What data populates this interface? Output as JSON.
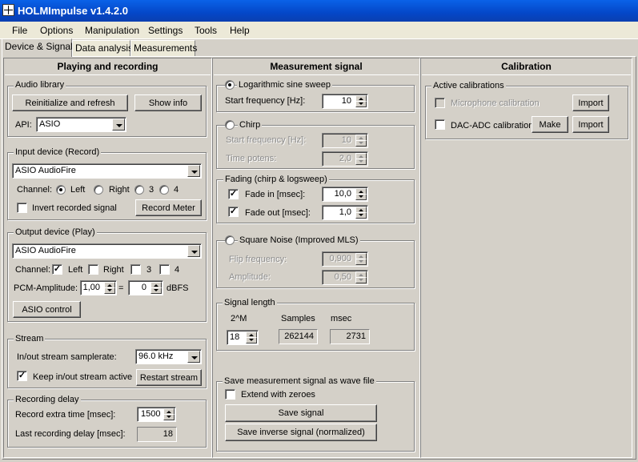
{
  "app": {
    "title": "HOLMImpulse  v1.4.2.0"
  },
  "menu": [
    "File",
    "Options",
    "Manipulation",
    "Settings",
    "Tools",
    "Help"
  ],
  "tabs": [
    "Device & Signal",
    "Data analysis",
    "Measurements"
  ],
  "col1": {
    "heading": "Playing and recording",
    "audio_library": {
      "title": "Audio library",
      "reinit_button": "Reinitialize and refresh",
      "show_info_button": "Show info",
      "api_label": "API:",
      "api_value": "ASIO"
    },
    "input_device": {
      "title": "Input device (Record)",
      "device": "ASIO AudioFire",
      "channel_label": "Channel:",
      "channels": [
        "Left",
        "Right",
        "3",
        "4"
      ],
      "invert_label": "Invert recorded signal",
      "record_meter_button": "Record Meter"
    },
    "output_device": {
      "title": "Output device (Play)",
      "device": "ASIO AudioFire",
      "channel_label": "Channel:",
      "channels": [
        "Left",
        "Right",
        "3",
        "4"
      ],
      "pcm_label": "PCM-Amplitude:",
      "pcm_value": "1,00",
      "equals": "=",
      "dbfs_value": "0",
      "dbfs_unit": "dBFS",
      "asio_button": "ASIO control"
    },
    "stream": {
      "title": "Stream",
      "samplerate_label": "In/out stream samplerate:",
      "samplerate_value": "96.0 kHz",
      "keep_label": "Keep in/out stream active",
      "restart_button": "Restart stream"
    },
    "recording_delay": {
      "title": "Recording delay",
      "extra_label": "Record extra time [msec]:",
      "extra_value": "1500",
      "last_label": "Last recording delay [msec]:",
      "last_value": "18"
    }
  },
  "col2": {
    "heading": "Measurement signal",
    "logsweep": {
      "title": "Logarithmic sine sweep",
      "start_label": "Start frequency [Hz]:",
      "start_value": "10"
    },
    "chirp": {
      "title": "Chirp",
      "start_label": "Start frequency [Hz]:",
      "start_value": "10",
      "time_label": "Time potens:",
      "time_value": "2,0"
    },
    "fading": {
      "title": "Fading (chirp & logsweep)",
      "fade_in_label": "Fade in [msec]:",
      "fade_in_value": "10,0",
      "fade_out_label": "Fade out [msec]:",
      "fade_out_value": "1,0"
    },
    "noise": {
      "title": "Square Noise (Improved MLS)",
      "flip_label": "Flip frequency:",
      "flip_value": "0,900",
      "amp_label": "Amplitude:",
      "amp_value": "0,50"
    },
    "length": {
      "title": "Signal length",
      "col_m": "2^M",
      "col_samples": "Samples",
      "col_msec": "msec",
      "m_value": "18",
      "samples_value": "262144",
      "msec_value": "2731"
    },
    "save": {
      "title": "Save measurement signal as wave file",
      "extend_label": "Extend with zeroes",
      "save_button": "Save signal",
      "save_inverse_button": "Save inverse signal (normalized)"
    }
  },
  "col3": {
    "heading": "Calibration",
    "active": {
      "title": "Active calibrations",
      "mic_label": "Microphone calibration",
      "mic_import": "Import",
      "dac_label": "DAC-ADC calibration",
      "dac_make": "Make",
      "dac_import": "Import"
    }
  }
}
